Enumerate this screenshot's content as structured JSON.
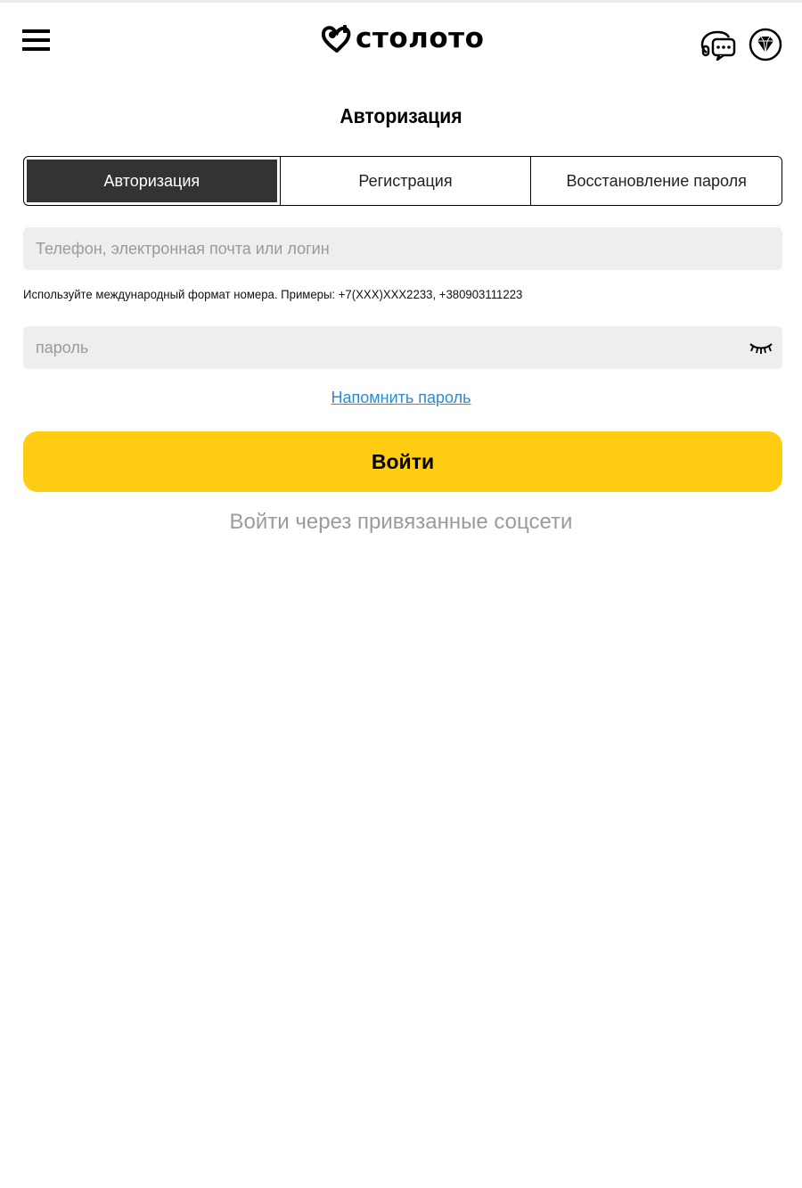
{
  "header": {
    "logo_text": "столото",
    "menu_icon": "hamburger-menu-icon",
    "chat_icon": "chat-support-icon",
    "gem_icon": "diamond-bonus-icon"
  },
  "page": {
    "title": "Авторизация"
  },
  "tabs": [
    {
      "label": "Авторизация",
      "active": true
    },
    {
      "label": "Регистрация",
      "active": false
    },
    {
      "label": "Восстановление пароля",
      "active": false
    }
  ],
  "form": {
    "login_placeholder": "Телефон, электронная почта или логин",
    "login_value": "",
    "hint": "Используйте международный формат номера. Примеры: +7(XXX)XXX2233, +380903111223",
    "password_placeholder": "пароль",
    "password_value": "",
    "forgot_link": "Напомнить пароль",
    "submit_label": "Войти",
    "social_login": "Войти через привязанные соцсети"
  },
  "colors": {
    "accent": "#ffcc12",
    "active_tab": "#333333",
    "link": "#2d8ad2",
    "field_bg": "#eeeeee",
    "muted_text": "#9b9b9b"
  }
}
